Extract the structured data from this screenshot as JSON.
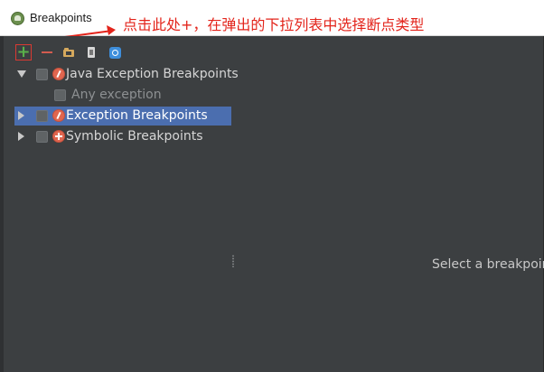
{
  "window": {
    "title": "Breakpoints"
  },
  "annotation": {
    "text": "点击此处+，在弹出的下拉列表中选择断点类型",
    "color": "#e3241b"
  },
  "toolbar": {
    "add": "+",
    "remove_icon": "minus-icon",
    "group_icon": "folder-icon",
    "view_icon": "document-icon",
    "config_icon": "settings-icon"
  },
  "tree": {
    "items": [
      {
        "label": "Java Exception Breakpoints",
        "expanded": true,
        "checked": false,
        "icon": "lightning-icon"
      },
      {
        "label": "Any exception",
        "checked": false,
        "disabled": true
      },
      {
        "label": "Exception Breakpoints",
        "expanded": false,
        "checked": false,
        "selected": true,
        "icon": "lightning-icon"
      },
      {
        "label": "Symbolic Breakpoints",
        "expanded": false,
        "checked": false,
        "icon": "symbolic-icon"
      }
    ]
  },
  "details": {
    "placeholder": "Select a breakpoin"
  },
  "colors": {
    "panel_background": "#3c3f41",
    "selection": "#4b6eaf",
    "text": "#d6d6d6",
    "muted_text": "#8d9092",
    "add_highlight": "#d93a32"
  }
}
